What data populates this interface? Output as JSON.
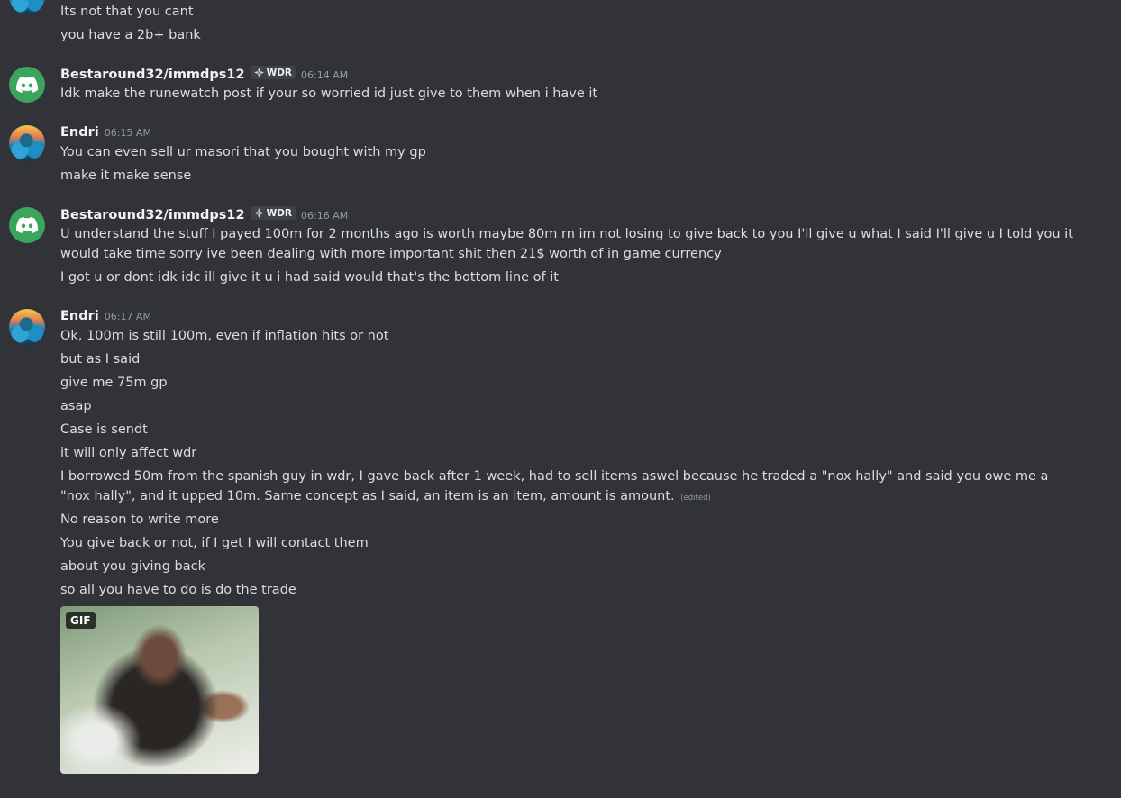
{
  "messages": [
    {
      "author": "",
      "lines": [
        "Its not that you cant",
        "you have a 2b+ bank"
      ]
    },
    {
      "author": "Bestaround32/immdps12",
      "tag": "WDR",
      "time": "06:14 AM",
      "lines": [
        "Idk make the runewatch post if your so worried id just give to them when i have it"
      ]
    },
    {
      "author": "Endri",
      "time": "06:15 AM",
      "lines": [
        "You can even sell ur masori that you bought with my gp",
        "make it make sense"
      ]
    },
    {
      "author": "Bestaround32/immdps12",
      "tag": "WDR",
      "time": "06:16 AM",
      "lines": [
        "U understand the stuff I payed 100m for 2 months ago is worth maybe 80m rn im not losing to give back to you I'll give u what I said I'll give u I told you it would take time sorry ive been dealing with more important shit then 21$ worth of in game currency",
        "I got u or dont idk idc ill give it u i had said would that's the bottom line of it"
      ]
    },
    {
      "author": "Endri",
      "time": "06:17 AM",
      "lines": [
        "Ok, 100m is still 100m, even if inflation hits or not",
        "but as I said",
        "give me 75m gp",
        "asap",
        "Case is sendt",
        "it will only affect wdr",
        "I borrowed 50m from the spanish guy in wdr, I gave back after 1 week, had to sell items aswel because he traded a \"nox hally\" and said you owe me a \"nox hally\", and it upped 10m. Same concept as I said, an item is an item, amount is amount.",
        "No reason to write more",
        "You give back or not, if I get I will contact them",
        "about you giving back",
        "so all you have to do is do the trade"
      ],
      "edited_label": "(edited)",
      "gif_badge": "GIF"
    }
  ],
  "colors": {
    "background": "#313338",
    "text": "#dbdee1",
    "username": "#f2f3f5",
    "timestamp": "#949ba4",
    "discord_avatar": "#3ba55c"
  },
  "icons": [
    "discord-icon",
    "server-tag-icon"
  ]
}
